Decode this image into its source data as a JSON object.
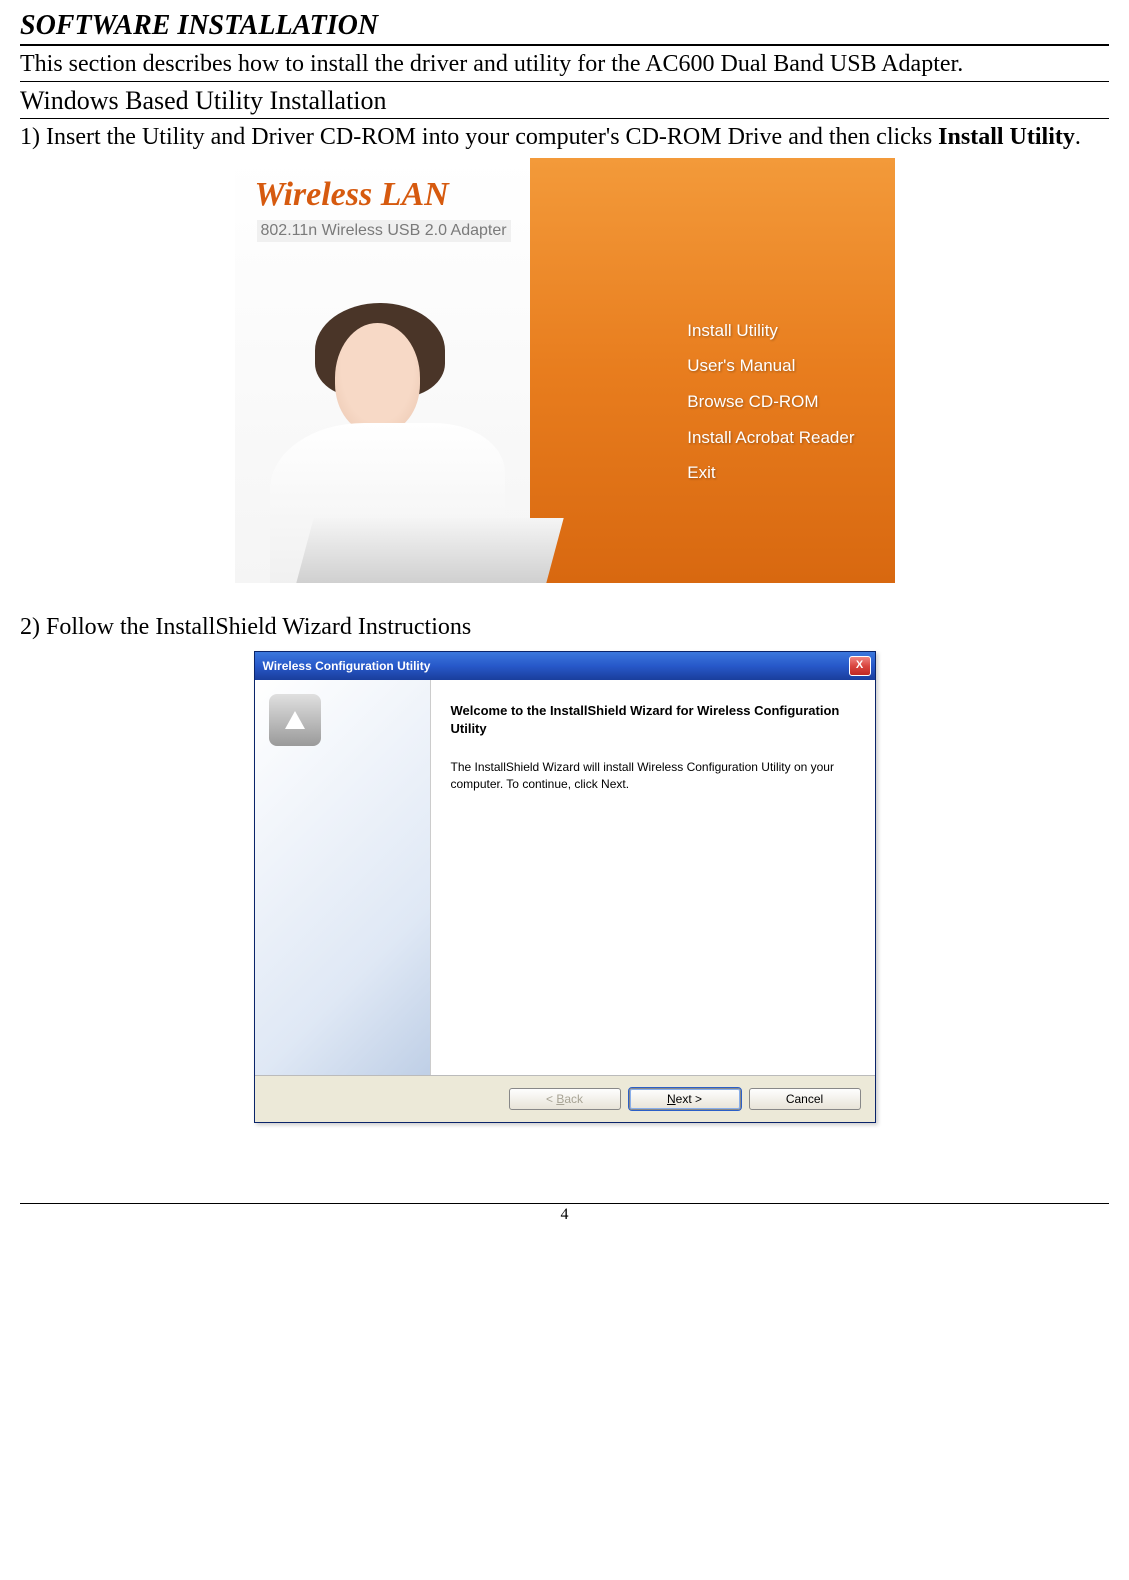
{
  "section_title": "SOFTWARE INSTALLATION",
  "intro": "This section describes how to install the driver and utility for the AC600 Dual Band USB Adapter.",
  "sub_title": "Windows Based Utility Installation",
  "step1_prefix": "1) Insert the Utility and Driver CD-ROM into your computer's CD-ROM Drive and then clicks ",
  "step1_bold": "Install Utility",
  "step1_suffix": ".",
  "cd": {
    "brand": "Wireless LAN",
    "brand_sub": "802.11n Wireless USB 2.0 Adapter",
    "menu": [
      "Install Utility",
      "User's Manual",
      "Browse CD-ROM",
      "Install Acrobat Reader",
      "Exit"
    ]
  },
  "step2": "2) Follow the InstallShield Wizard Instructions",
  "wizard": {
    "title": "Wireless Configuration Utility",
    "close": "X",
    "welcome": "Welcome to the InstallShield Wizard for Wireless Configuration Utility",
    "desc": "The InstallShield Wizard will install Wireless Configuration Utility on your computer.  To continue, click Next.",
    "back_prefix": "< ",
    "back_under": "B",
    "back_rest": "ack",
    "next_under": "N",
    "next_rest": "ext >",
    "cancel": "Cancel"
  },
  "page_number": "4"
}
